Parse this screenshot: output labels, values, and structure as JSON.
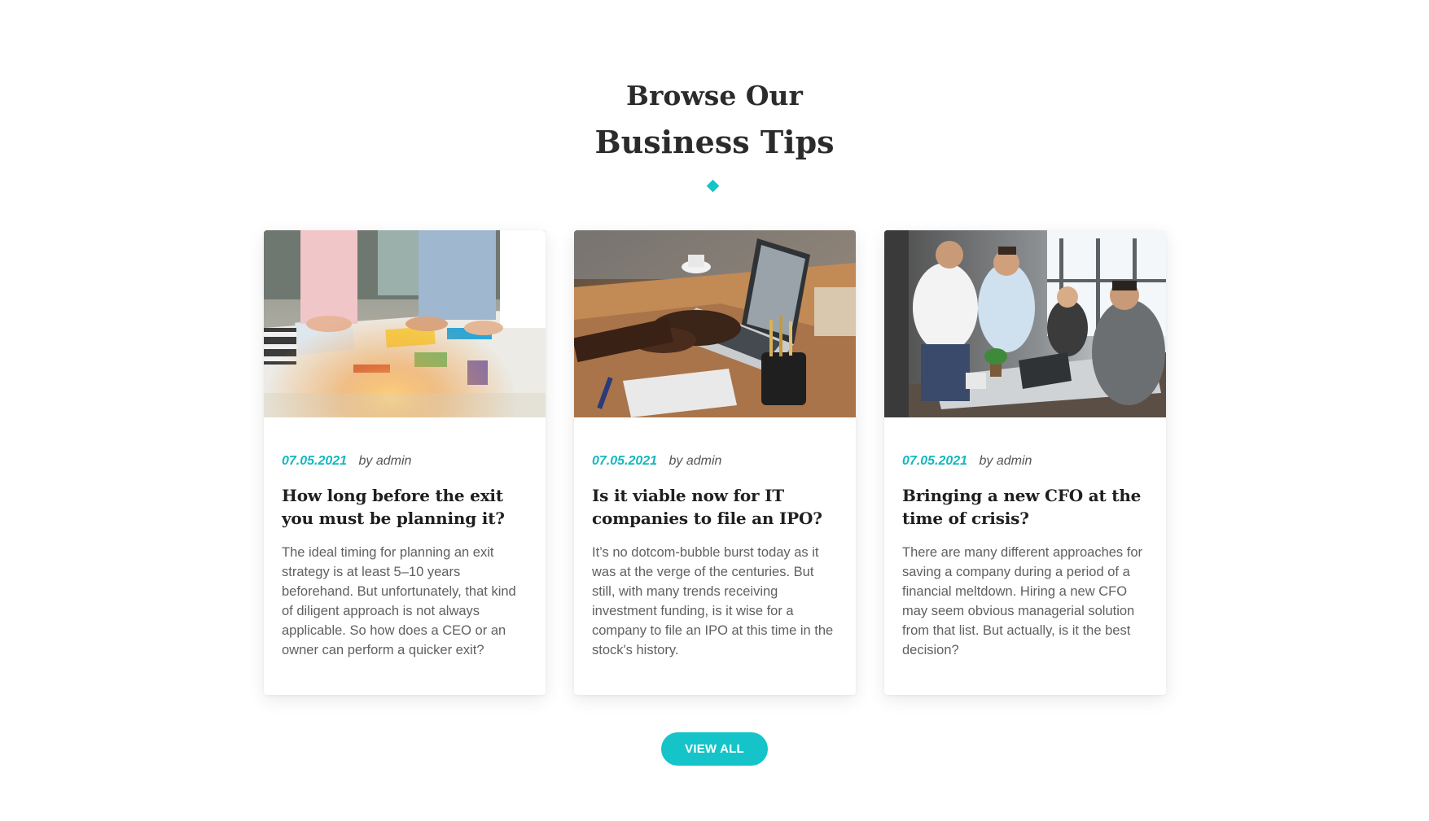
{
  "section": {
    "heading_line1": "Browse Our",
    "heading_line2": "Business Tips",
    "accent_color": "#14c4c8"
  },
  "posts": [
    {
      "image_icon": "team-planning-photo",
      "date": "07.05.2021",
      "author": "by admin",
      "title": "How long before the exit you must be planning it?",
      "excerpt": "The ideal timing for planning an exit strategy is at least 5–10 years beforehand. But unfortunately, that kind of diligent approach is not always applicable. So how does a CEO or an owner can perform a quicker exit?"
    },
    {
      "image_icon": "laptop-desk-photo",
      "date": "07.05.2021",
      "author": "by admin",
      "title": "Is it viable now for IT companies to file an IPO?",
      "excerpt": "It’s no dotcom-bubble burst today as it was at the verge of the centuries. But still, with many trends receiving investment funding, is it wise for a company to file an IPO at this time in the stock's history."
    },
    {
      "image_icon": "office-handshake-photo",
      "date": "07.05.2021",
      "author": "by admin",
      "title": "Bringing a new CFO at the time of crisis?",
      "excerpt": "There are many different approaches for saving a company during a period of a financial meltdown. Hiring a new CFO may seem obvious managerial solution from that list. But actually, is it the best decision?"
    }
  ],
  "view_all_label": "VIEW ALL"
}
